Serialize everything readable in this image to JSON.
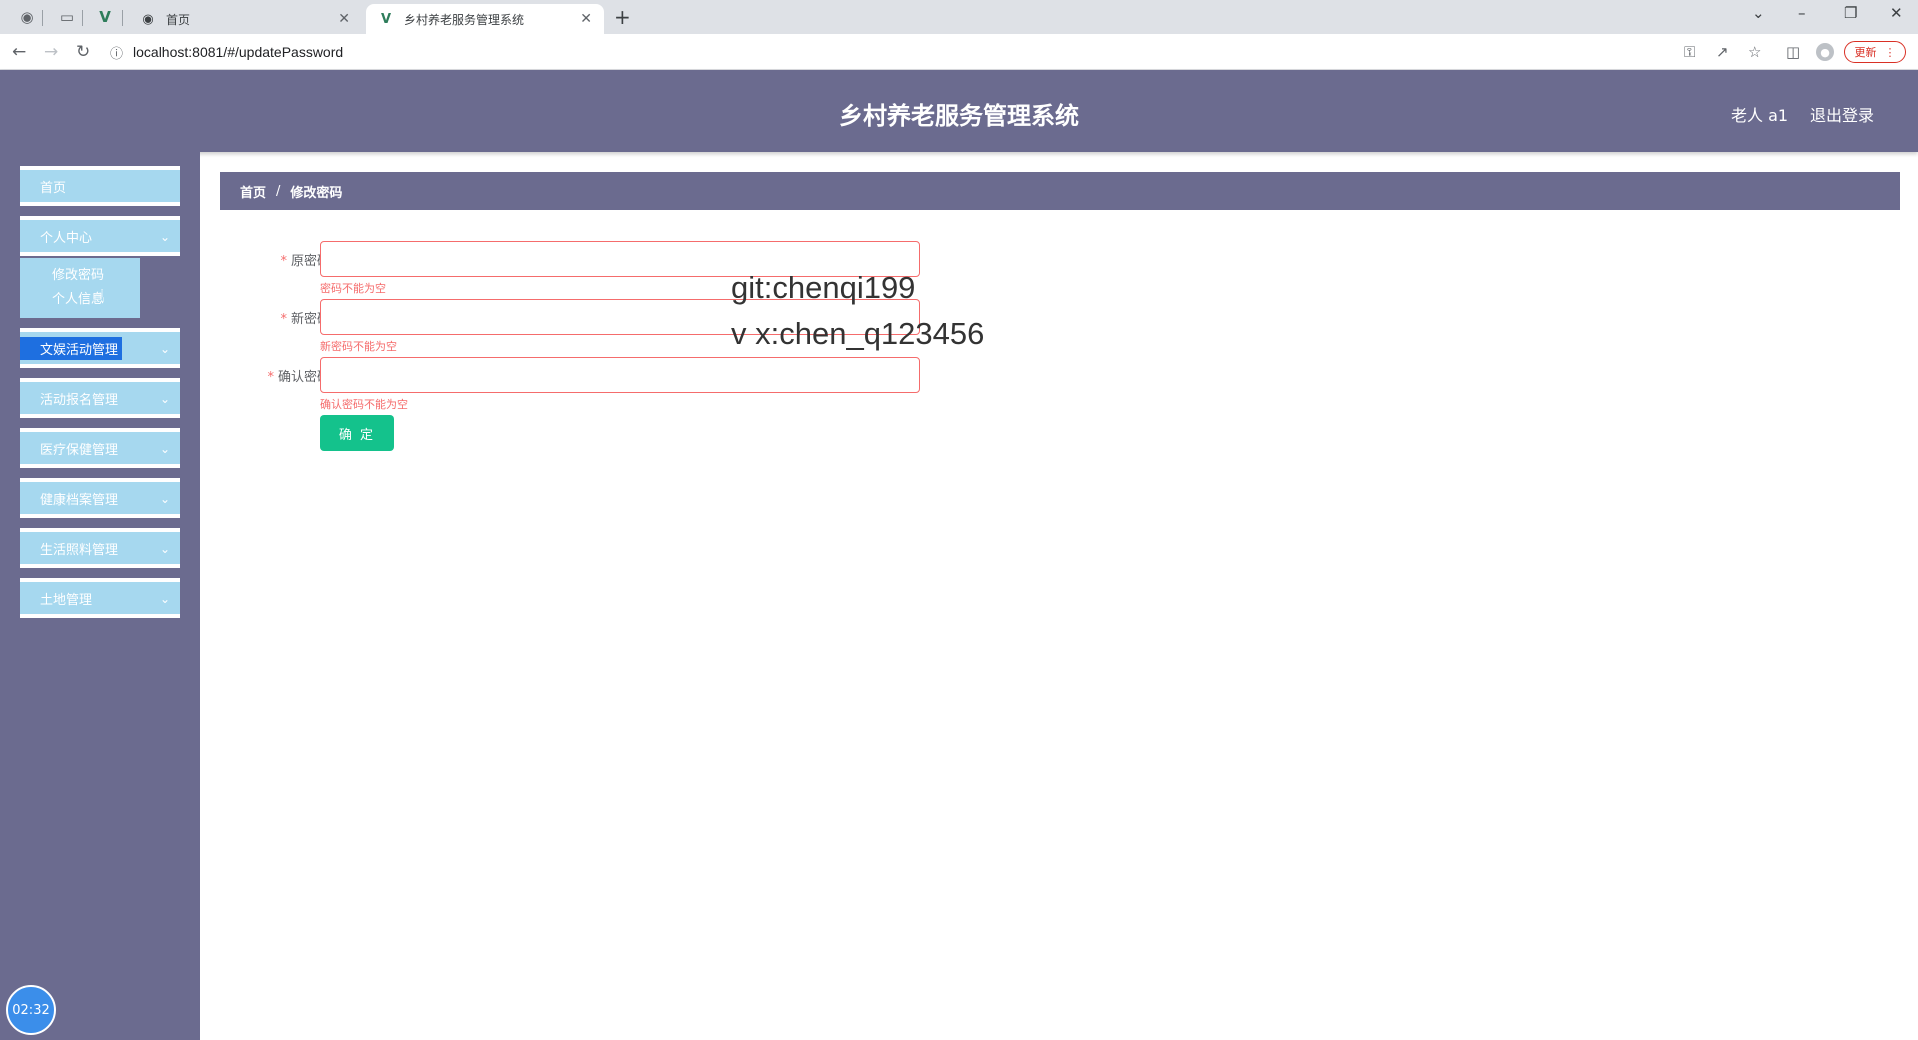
{
  "browser": {
    "tabs": [
      {
        "title": "首页",
        "active": false
      },
      {
        "title": "乡村养老服务管理系统",
        "active": true
      }
    ],
    "url": "localhost:8081/#/updatePassword",
    "update_label": "更新",
    "accent": "#d93025"
  },
  "header": {
    "title": "乡村养老服务管理系统",
    "user": "老人 a1",
    "logout": "退出登录",
    "bg_color": "#6b6b8f"
  },
  "sidebar": {
    "items": [
      {
        "label": "首页"
      },
      {
        "label": "个人中心"
      },
      {
        "label": "文娱活动管理"
      },
      {
        "label": "活动报名管理"
      },
      {
        "label": "医疗保健管理"
      },
      {
        "label": "健康档案管理"
      },
      {
        "label": "生活照料管理"
      },
      {
        "label": "土地管理"
      }
    ],
    "submenu": [
      {
        "label": "修改密码"
      },
      {
        "label": "个人信息"
      }
    ],
    "clock": "02:32",
    "item_color": "#a6d8ef"
  },
  "breadcrumb": {
    "home": "首页",
    "sep": "/",
    "current": "修改密码"
  },
  "form": {
    "fields": [
      {
        "label": "原密码",
        "value": "",
        "error": "密码不能为空"
      },
      {
        "label": "新密码",
        "value": "",
        "error": "新密码不能为空"
      },
      {
        "label": "确认密码",
        "value": "",
        "error": "确认密码不能为空"
      }
    ],
    "submit": "确 定",
    "submit_color": "#14c28c",
    "error_color": "#f56c6c"
  },
  "watermark": {
    "line1": "git:chenqi199",
    "line2": "v x:chen_q123456"
  }
}
